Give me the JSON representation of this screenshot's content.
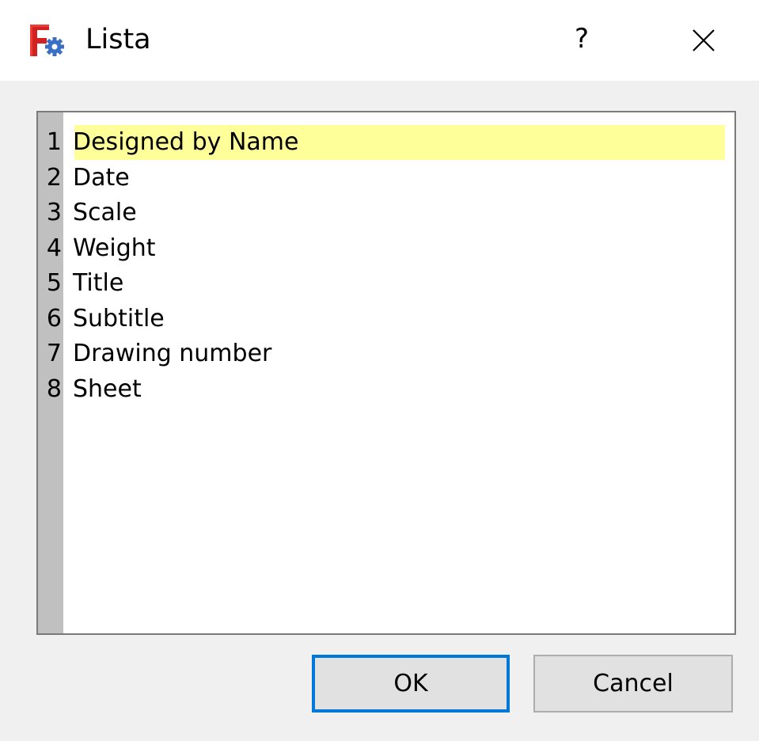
{
  "window": {
    "title": "Lista",
    "help_label": "?",
    "close_icon": "close-icon",
    "app_icon": "app-gear-icon"
  },
  "colors": {
    "highlight": "#ffff99",
    "focus_border": "#0078d7",
    "gutter": "#c0c0c0",
    "dialog_bg": "#f0f0f0"
  },
  "list": {
    "selected_index": 0,
    "items": [
      {
        "num": "1",
        "label": "Designed by Name"
      },
      {
        "num": "2",
        "label": "Date"
      },
      {
        "num": "3",
        "label": "Scale"
      },
      {
        "num": "4",
        "label": "Weight"
      },
      {
        "num": "5",
        "label": "Title"
      },
      {
        "num": "6",
        "label": "Subtitle"
      },
      {
        "num": "7",
        "label": "Drawing number"
      },
      {
        "num": "8",
        "label": "Sheet"
      }
    ]
  },
  "buttons": {
    "ok_label": "OK",
    "cancel_label": "Cancel"
  }
}
